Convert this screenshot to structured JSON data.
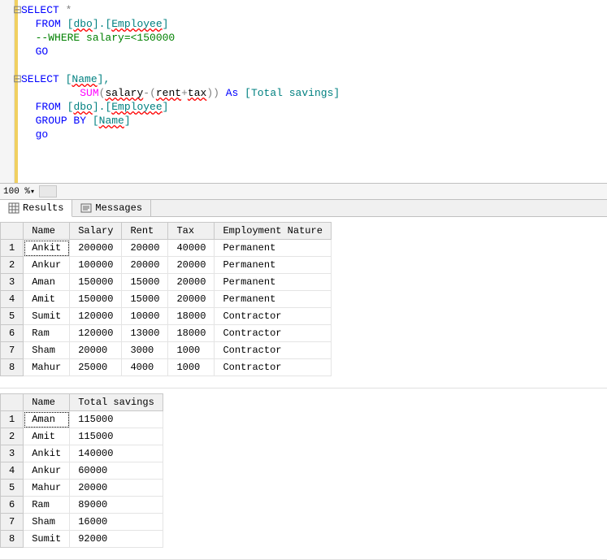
{
  "zoom": "100 %",
  "code": {
    "line1_kw1": "SELECT",
    "line1_star": " *",
    "line2_kw": "FROM",
    "line2_bracket_open": " [",
    "line2_dbo": "dbo",
    "line2_dot": "].[",
    "line2_emp": "Employee",
    "line2_bracket_close": "]",
    "line3_comment": "--WHERE salary=<150000",
    "line4_go": "GO",
    "line6_kw": "SELECT",
    "line6_bracket_open": " [",
    "line6_name": "Name",
    "line6_rest": "],",
    "line7_sum": "SUM",
    "line7_popen": "(",
    "line7_salary": "salary",
    "line7_minus": "-",
    "line7_popen2": "(",
    "line7_rent": "rent",
    "line7_plus": "+",
    "line7_tax": "tax",
    "line7_pclose": "))",
    "line7_as": " As ",
    "line7_alias_open": "[",
    "line7_alias": "Total savings",
    "line7_alias_close": "]",
    "line8_kw": "FROM",
    "line8_bracket_open": " [",
    "line8_dbo": "dbo",
    "line8_dot": "].[",
    "line8_emp": "Employee",
    "line8_bracket_close": "]",
    "line9_kw": "GROUP BY",
    "line9_bracket_open": " [",
    "line9_name": "Name",
    "line9_bracket_close": "]",
    "line10_go": "go"
  },
  "tabs": {
    "results": "Results",
    "messages": "Messages"
  },
  "grid1": {
    "headers": [
      "Name",
      "Salary",
      "Rent",
      "Tax",
      "Employment Nature"
    ],
    "rows": [
      [
        "Ankit",
        "200000",
        "20000",
        "40000",
        "Permanent"
      ],
      [
        "Ankur",
        "100000",
        "20000",
        "20000",
        "Permanent"
      ],
      [
        "Aman",
        "150000",
        "15000",
        "20000",
        "Permanent"
      ],
      [
        "Amit",
        "150000",
        "15000",
        "20000",
        "Permanent"
      ],
      [
        "Sumit",
        "120000",
        "10000",
        "18000",
        "Contractor"
      ],
      [
        "Ram",
        "120000",
        "13000",
        "18000",
        "Contractor"
      ],
      [
        "Sham",
        "20000",
        "3000",
        "1000",
        "Contractor"
      ],
      [
        "Mahur",
        "25000",
        "4000",
        "1000",
        "Contractor"
      ]
    ]
  },
  "grid2": {
    "headers": [
      "Name",
      "Total savings"
    ],
    "rows": [
      [
        "Aman",
        "115000"
      ],
      [
        "Amit",
        "115000"
      ],
      [
        "Ankit",
        "140000"
      ],
      [
        "Ankur",
        "60000"
      ],
      [
        "Mahur",
        "20000"
      ],
      [
        "Ram",
        "89000"
      ],
      [
        "Sham",
        "16000"
      ],
      [
        "Sumit",
        "92000"
      ]
    ]
  }
}
